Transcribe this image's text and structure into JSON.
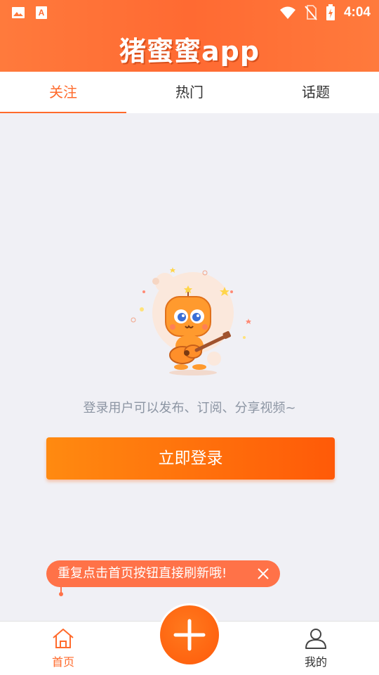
{
  "status_bar": {
    "time": "4:04",
    "left_icons": [
      "image-icon",
      "app-a-icon"
    ],
    "right_icons": [
      "wifi-icon",
      "no-sim-icon",
      "battery-charging-icon"
    ]
  },
  "header": {
    "title": "猪蜜蜜app",
    "color": "#ff6a32"
  },
  "tabs": [
    {
      "label": "关注",
      "active": true
    },
    {
      "label": "热门",
      "active": false
    },
    {
      "label": "话题",
      "active": false
    }
  ],
  "empty_state": {
    "illustration": "guitar-mascot-icon",
    "message": "登录用户可以发布、订阅、分享视频~",
    "login_button": "立即登录"
  },
  "tip": {
    "text": "重复点击首页按钮直接刷新哦!",
    "close_icon": "close-icon"
  },
  "bottom_nav": {
    "home_label": "首页",
    "me_label": "我的",
    "add_icon": "plus-icon"
  },
  "colors": {
    "accent": "#ff6a2b",
    "button_gradient_start": "#ff8a10",
    "button_gradient_end": "#ff5a08",
    "tip_bg": "#ff7248"
  }
}
